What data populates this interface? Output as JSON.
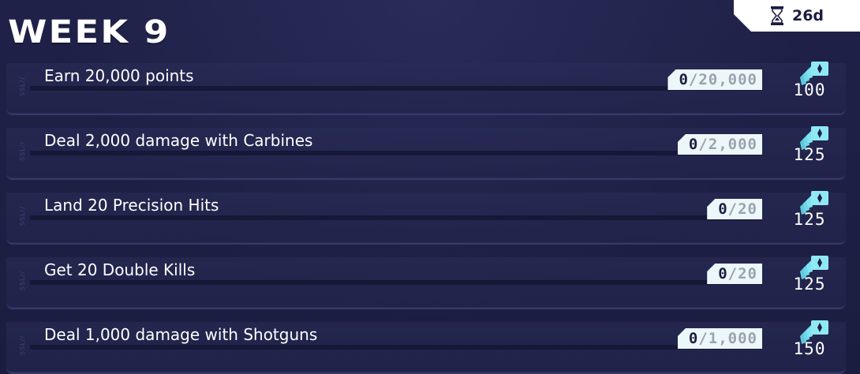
{
  "header": {
    "title": "WEEK 9",
    "timer": {
      "icon": "hourglass-icon",
      "remaining": "26d"
    }
  },
  "challenges": [
    {
      "tag": "SSL//",
      "description": "Earn 20,000 points",
      "current": "0",
      "goal": "20,000",
      "reward": "100"
    },
    {
      "tag": "SSL//",
      "description": "Deal 2,000 damage with Carbines",
      "current": "0",
      "goal": "2,000",
      "reward": "125"
    },
    {
      "tag": "SSL//",
      "description": "Land 20 Precision Hits",
      "current": "0",
      "goal": "20",
      "reward": "125"
    },
    {
      "tag": "SSL//",
      "description": "Get 20 Double Kills",
      "current": "0",
      "goal": "20",
      "reward": "125"
    },
    {
      "tag": "SSL//",
      "description": "Deal 1,000 damage with Shotguns",
      "current": "0",
      "goal": "1,000",
      "reward": "150"
    }
  ],
  "colors": {
    "background": "#1d1f45",
    "badge": "#ecf7fa",
    "reward_icon": "#7fe3f2",
    "text": "#ffffff"
  }
}
